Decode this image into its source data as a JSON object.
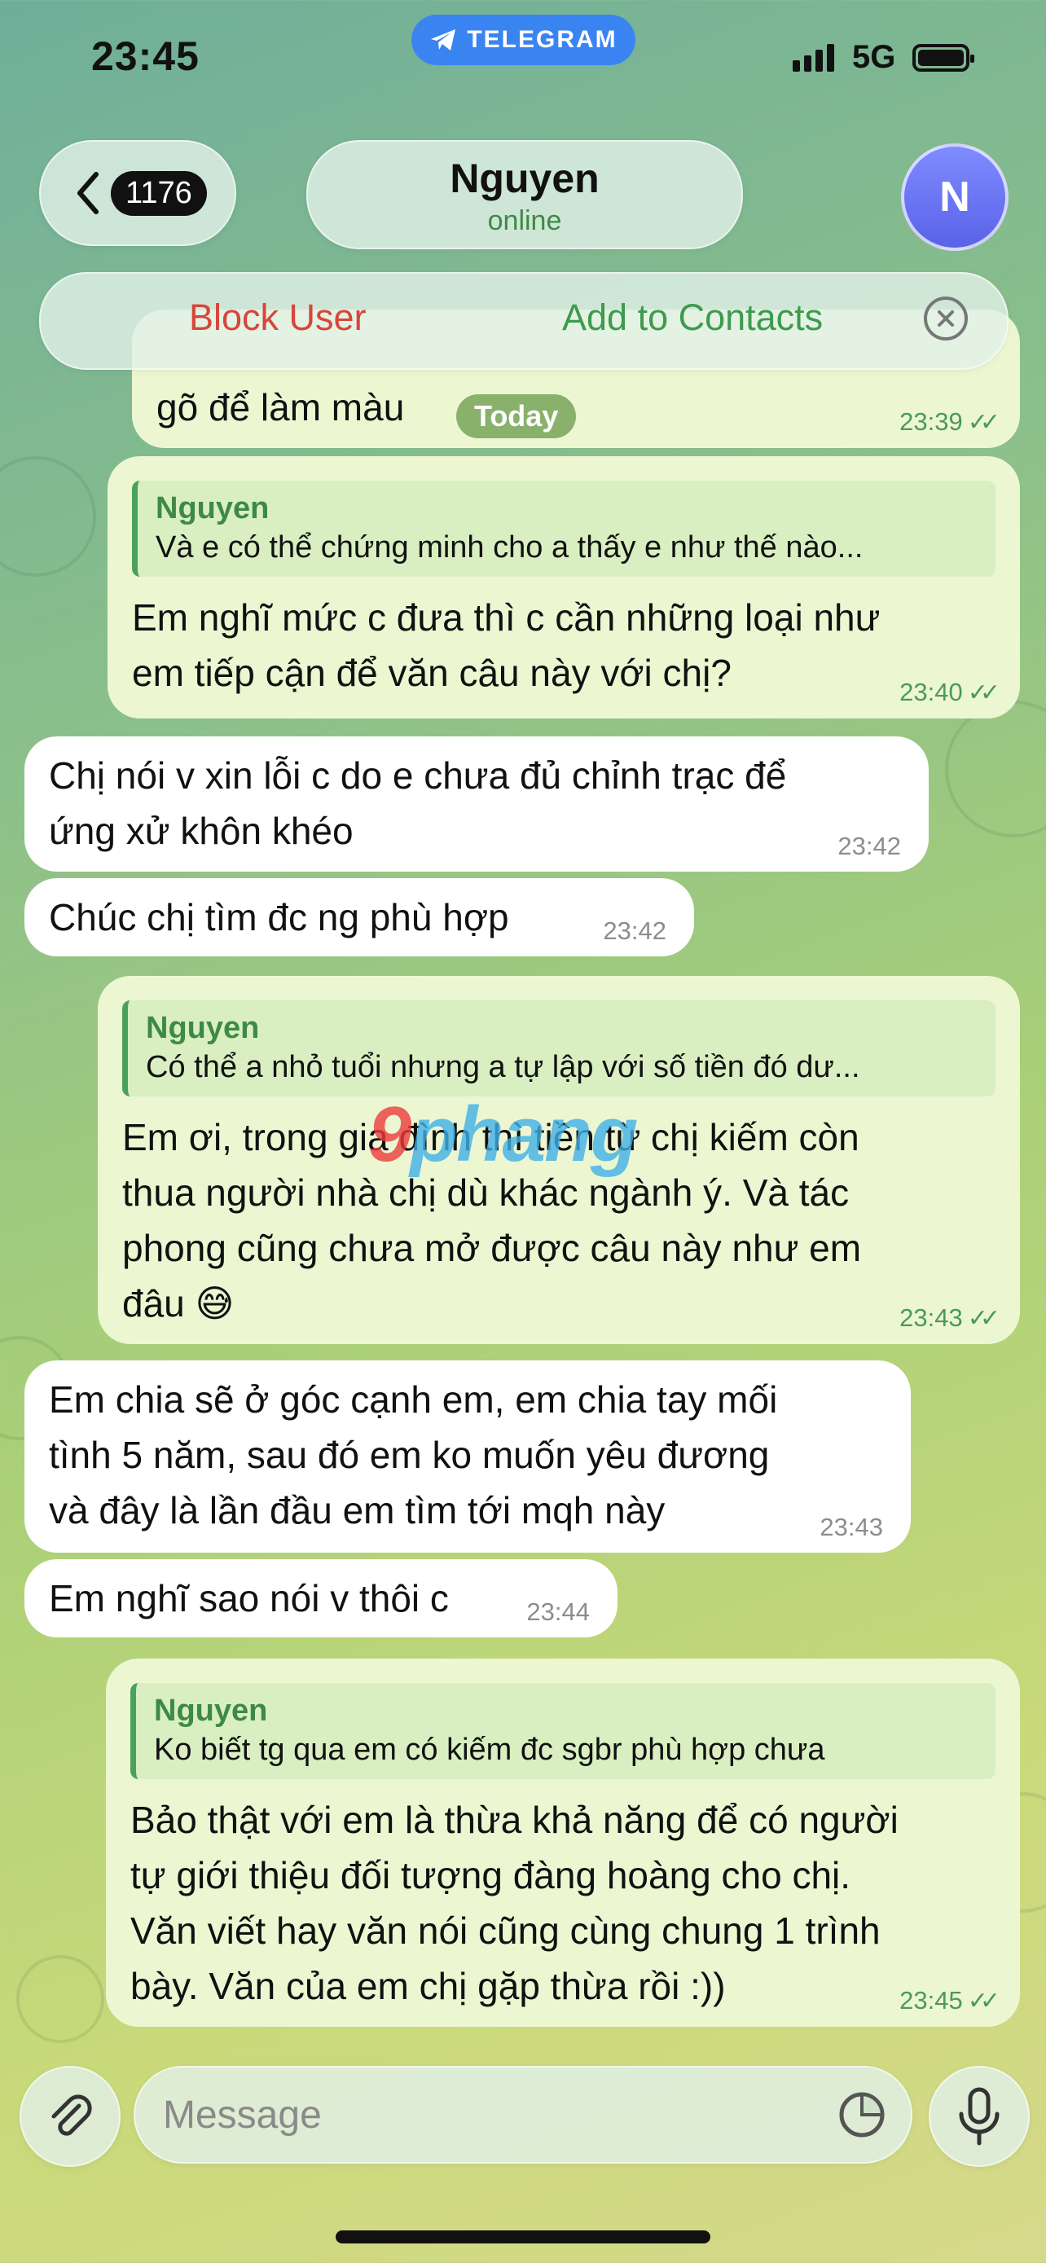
{
  "status": {
    "time": "23:45",
    "network": "5G",
    "telegram_label": "TELEGRAM"
  },
  "header": {
    "back_count": "1176",
    "name": "Nguyen",
    "presence": "online",
    "avatar_initial": "N"
  },
  "actions": {
    "block": "Block User",
    "add": "Add to Contacts"
  },
  "date_chip": "Today",
  "top_partial": {
    "text": "gõ để làm màu",
    "time": "23:39"
  },
  "messages": [
    {
      "reply_name": "Nguyen",
      "reply_text": "Và e có thể chứng minh cho a thấy e như thế nào...",
      "lines": [
        "Em nghĩ mức c đưa thì c cần những loại như",
        "em tiếp cận để văn câu này với chị?"
      ],
      "time": "23:40"
    },
    {
      "lines": [
        "Chị nói v xin lỗi c do e chưa đủ chỉnh trạc để",
        "ứng xử khôn khéo"
      ],
      "time": "23:42"
    },
    {
      "lines": [
        "Chúc chị tìm đc ng phù hợp"
      ],
      "time": "23:42"
    },
    {
      "reply_name": "Nguyen",
      "reply_text": "Có thể a nhỏ tuổi nhưng a tự lập với số tiền đó dư...",
      "lines": [
        "Em ơi, trong gia đình thì tiền từ chị kiếm còn",
        "thua người nhà chị dù khác ngành ý. Và tác",
        "phong cũng chưa mở được câu này như em",
        "đâu 😅"
      ],
      "time": "23:43"
    },
    {
      "lines": [
        "Em chia sẽ ở góc cạnh em, em chia tay mối",
        "tình 5 năm, sau đó em ko muốn yêu đương",
        "và đây là lần đầu em tìm tới mqh này"
      ],
      "time": "23:43"
    },
    {
      "lines": [
        "Em nghĩ sao nói v thôi c"
      ],
      "time": "23:44"
    },
    {
      "reply_name": "Nguyen",
      "reply_text": "Ko biết tg qua em có kiếm đc sgbr phù hợp chưa",
      "lines": [
        "Bảo thật với em là thừa khả năng để có người",
        "tự giới thiệu đối tượng đàng hoàng cho chị.",
        "Văn viết hay văn nói cũng cùng chung 1 trình",
        "bày. Văn của em chị gặp thừa rồi :))"
      ],
      "time": "23:45"
    }
  ],
  "watermark": {
    "left": "9",
    "right": "phang"
  },
  "input": {
    "placeholder": "Message"
  },
  "colors": {
    "outgoing": "#ecf7d2",
    "incoming": "#ffffff",
    "accent": "#3e8a45",
    "danger": "#d8453b"
  }
}
